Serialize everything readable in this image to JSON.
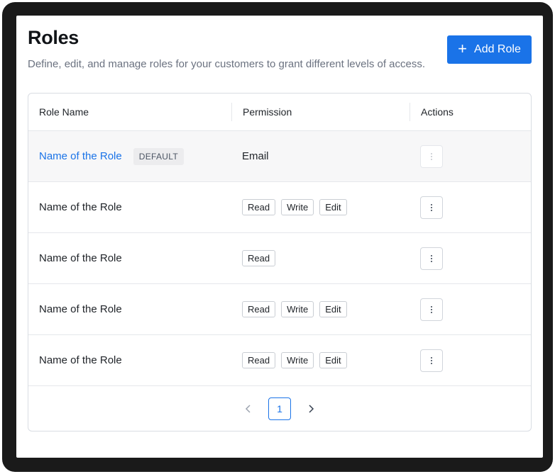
{
  "header": {
    "title": "Roles",
    "subtitle": "Define, edit, and manage roles for your customers to grant different levels of access.",
    "add_button_label": "Add Role"
  },
  "table": {
    "columns": [
      "Role Name",
      "Permission",
      "Actions"
    ],
    "rows": [
      {
        "name": "Name of the Role",
        "badge": "DEFAULT",
        "permission_text": "Email",
        "tags": [],
        "is_link": true,
        "actions_disabled": true
      },
      {
        "name": "Name of the Role",
        "badge": "",
        "permission_text": "",
        "tags": [
          "Read",
          "Write",
          "Edit"
        ],
        "is_link": false,
        "actions_disabled": false
      },
      {
        "name": "Name of the Role",
        "badge": "",
        "permission_text": "",
        "tags": [
          "Read"
        ],
        "is_link": false,
        "actions_disabled": false
      },
      {
        "name": "Name of the Role",
        "badge": "",
        "permission_text": "",
        "tags": [
          "Read",
          "Write",
          "Edit"
        ],
        "is_link": false,
        "actions_disabled": false
      },
      {
        "name": "Name of the Role",
        "badge": "",
        "permission_text": "",
        "tags": [
          "Read",
          "Write",
          "Edit"
        ],
        "is_link": false,
        "actions_disabled": false
      }
    ]
  },
  "pagination": {
    "current_page": "1",
    "prev_icon": "chevron-left-icon",
    "next_icon": "chevron-right-icon"
  },
  "colors": {
    "accent": "#1a73e8",
    "frame": "#1a1a1a",
    "highlight_row": "#f7f7f8"
  }
}
